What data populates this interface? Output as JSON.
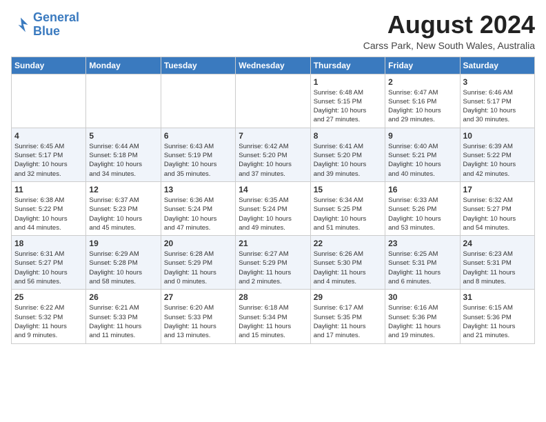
{
  "logo": {
    "line1": "General",
    "line2": "Blue"
  },
  "title": {
    "month_year": "August 2024",
    "location": "Carss Park, New South Wales, Australia"
  },
  "days_of_week": [
    "Sunday",
    "Monday",
    "Tuesday",
    "Wednesday",
    "Thursday",
    "Friday",
    "Saturday"
  ],
  "weeks": [
    [
      {
        "day": "",
        "info": ""
      },
      {
        "day": "",
        "info": ""
      },
      {
        "day": "",
        "info": ""
      },
      {
        "day": "",
        "info": ""
      },
      {
        "day": "1",
        "info": "Sunrise: 6:48 AM\nSunset: 5:15 PM\nDaylight: 10 hours\nand 27 minutes."
      },
      {
        "day": "2",
        "info": "Sunrise: 6:47 AM\nSunset: 5:16 PM\nDaylight: 10 hours\nand 29 minutes."
      },
      {
        "day": "3",
        "info": "Sunrise: 6:46 AM\nSunset: 5:17 PM\nDaylight: 10 hours\nand 30 minutes."
      }
    ],
    [
      {
        "day": "4",
        "info": "Sunrise: 6:45 AM\nSunset: 5:17 PM\nDaylight: 10 hours\nand 32 minutes."
      },
      {
        "day": "5",
        "info": "Sunrise: 6:44 AM\nSunset: 5:18 PM\nDaylight: 10 hours\nand 34 minutes."
      },
      {
        "day": "6",
        "info": "Sunrise: 6:43 AM\nSunset: 5:19 PM\nDaylight: 10 hours\nand 35 minutes."
      },
      {
        "day": "7",
        "info": "Sunrise: 6:42 AM\nSunset: 5:20 PM\nDaylight: 10 hours\nand 37 minutes."
      },
      {
        "day": "8",
        "info": "Sunrise: 6:41 AM\nSunset: 5:20 PM\nDaylight: 10 hours\nand 39 minutes."
      },
      {
        "day": "9",
        "info": "Sunrise: 6:40 AM\nSunset: 5:21 PM\nDaylight: 10 hours\nand 40 minutes."
      },
      {
        "day": "10",
        "info": "Sunrise: 6:39 AM\nSunset: 5:22 PM\nDaylight: 10 hours\nand 42 minutes."
      }
    ],
    [
      {
        "day": "11",
        "info": "Sunrise: 6:38 AM\nSunset: 5:22 PM\nDaylight: 10 hours\nand 44 minutes."
      },
      {
        "day": "12",
        "info": "Sunrise: 6:37 AM\nSunset: 5:23 PM\nDaylight: 10 hours\nand 45 minutes."
      },
      {
        "day": "13",
        "info": "Sunrise: 6:36 AM\nSunset: 5:24 PM\nDaylight: 10 hours\nand 47 minutes."
      },
      {
        "day": "14",
        "info": "Sunrise: 6:35 AM\nSunset: 5:24 PM\nDaylight: 10 hours\nand 49 minutes."
      },
      {
        "day": "15",
        "info": "Sunrise: 6:34 AM\nSunset: 5:25 PM\nDaylight: 10 hours\nand 51 minutes."
      },
      {
        "day": "16",
        "info": "Sunrise: 6:33 AM\nSunset: 5:26 PM\nDaylight: 10 hours\nand 53 minutes."
      },
      {
        "day": "17",
        "info": "Sunrise: 6:32 AM\nSunset: 5:27 PM\nDaylight: 10 hours\nand 54 minutes."
      }
    ],
    [
      {
        "day": "18",
        "info": "Sunrise: 6:31 AM\nSunset: 5:27 PM\nDaylight: 10 hours\nand 56 minutes."
      },
      {
        "day": "19",
        "info": "Sunrise: 6:29 AM\nSunset: 5:28 PM\nDaylight: 10 hours\nand 58 minutes."
      },
      {
        "day": "20",
        "info": "Sunrise: 6:28 AM\nSunset: 5:29 PM\nDaylight: 11 hours\nand 0 minutes."
      },
      {
        "day": "21",
        "info": "Sunrise: 6:27 AM\nSunset: 5:29 PM\nDaylight: 11 hours\nand 2 minutes."
      },
      {
        "day": "22",
        "info": "Sunrise: 6:26 AM\nSunset: 5:30 PM\nDaylight: 11 hours\nand 4 minutes."
      },
      {
        "day": "23",
        "info": "Sunrise: 6:25 AM\nSunset: 5:31 PM\nDaylight: 11 hours\nand 6 minutes."
      },
      {
        "day": "24",
        "info": "Sunrise: 6:23 AM\nSunset: 5:31 PM\nDaylight: 11 hours\nand 8 minutes."
      }
    ],
    [
      {
        "day": "25",
        "info": "Sunrise: 6:22 AM\nSunset: 5:32 PM\nDaylight: 11 hours\nand 9 minutes."
      },
      {
        "day": "26",
        "info": "Sunrise: 6:21 AM\nSunset: 5:33 PM\nDaylight: 11 hours\nand 11 minutes."
      },
      {
        "day": "27",
        "info": "Sunrise: 6:20 AM\nSunset: 5:33 PM\nDaylight: 11 hours\nand 13 minutes."
      },
      {
        "day": "28",
        "info": "Sunrise: 6:18 AM\nSunset: 5:34 PM\nDaylight: 11 hours\nand 15 minutes."
      },
      {
        "day": "29",
        "info": "Sunrise: 6:17 AM\nSunset: 5:35 PM\nDaylight: 11 hours\nand 17 minutes."
      },
      {
        "day": "30",
        "info": "Sunrise: 6:16 AM\nSunset: 5:36 PM\nDaylight: 11 hours\nand 19 minutes."
      },
      {
        "day": "31",
        "info": "Sunrise: 6:15 AM\nSunset: 5:36 PM\nDaylight: 11 hours\nand 21 minutes."
      }
    ]
  ]
}
